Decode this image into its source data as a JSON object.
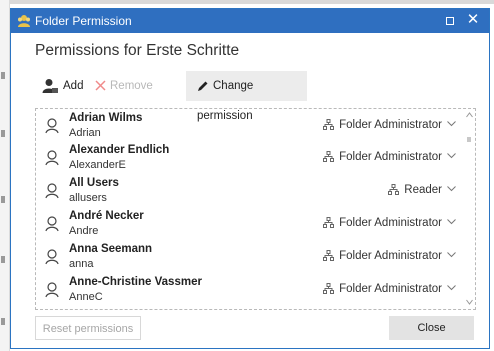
{
  "window": {
    "title": "Folder Permission",
    "close_glyph": "✕",
    "accent_color": "#2f6fc0"
  },
  "heading": "Permissions for Erste Schritte",
  "toolbar": {
    "add_label": "Add",
    "remove_label": "Remove",
    "change_label": "Change permission"
  },
  "list": {
    "rows": [
      {
        "name": "Adrian Wilms",
        "login": "Adrian",
        "permission": "Folder Administrator"
      },
      {
        "name": "Alexander Endlich",
        "login": "AlexanderE",
        "permission": "Folder Administrator"
      },
      {
        "name": "All Users",
        "login": "allusers",
        "permission": "Reader"
      },
      {
        "name": "André Necker",
        "login": "Andre",
        "permission": "Folder Administrator"
      },
      {
        "name": "Anna Seemann",
        "login": "anna",
        "permission": "Folder Administrator"
      },
      {
        "name": "Anne-Christine Vassmer",
        "login": "AnneC",
        "permission": "Folder Administrator"
      }
    ]
  },
  "footer": {
    "reset_label": "Reset permissions",
    "close_label": "Close"
  },
  "icons": {
    "app": "folder-users-icon",
    "user": "user-outline-icon",
    "permission": "org-chart-icon",
    "dropdown": "chevron-down-icon"
  }
}
